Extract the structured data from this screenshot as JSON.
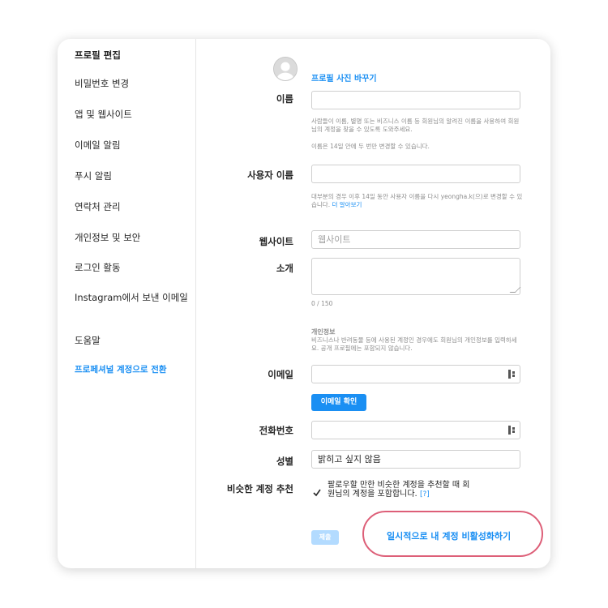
{
  "sidebar": {
    "items": [
      {
        "label": "프로필 편집"
      },
      {
        "label": "비밀번호 변경"
      },
      {
        "label": "앱 및 웹사이트"
      },
      {
        "label": "이메일 알림"
      },
      {
        "label": "푸시 알림"
      },
      {
        "label": "연락처 관리"
      },
      {
        "label": "개인정보 및 보안"
      },
      {
        "label": "로그인 활동"
      },
      {
        "label": "Instagram에서 보낸 이메일"
      },
      {
        "label": "도움말"
      },
      {
        "label": "프로페셔널 계정으로 전환"
      }
    ]
  },
  "profile": {
    "change_photo": "프로필 사진 바꾸기"
  },
  "form": {
    "name_label": "이름",
    "name_value": "",
    "name_help": "사람들이 이름, 별명 또는 비즈니스 이름 등 회원님의 알려진 이름을 사용하여 회원님의 계정을 찾을 수 있도록 도와주세요.",
    "name_help2": "이름은 14일 안에 두 번만 변경할 수 있습니다.",
    "username_label": "사용자 이름",
    "username_value": "",
    "username_help": "대부분의 경우 이후 14일 동안 사용자 이름을 다시 yeongha.k(으)로 변경할 수 있습니다.",
    "username_help_link": "더 알아보기",
    "website_label": "웹사이트",
    "website_placeholder": "웹사이트",
    "bio_label": "소개",
    "bio_counter": "0 / 150",
    "personal_title": "개인정보",
    "personal_help": "비즈니스나 반려동물 등에 사용된 계정인 경우에도 회원님의 개인정보를 입력하세요. 공개 프로필에는 포함되지 않습니다.",
    "email_label": "이메일",
    "email_value": "",
    "email_confirm": "이메일 확인",
    "phone_label": "전화번호",
    "phone_value": "",
    "gender_label": "성별",
    "gender_value": "밝히고 싶지 않음",
    "similar_label": "비슷한 계정 추천",
    "similar_text": "팔로우할 만한 비슷한 계정을 추천할 때 회원님의 계정을 포함합니다.",
    "similar_help": "[?]",
    "submit": "제출",
    "deactivate": "일시적으로 내 계정 비활성화하기"
  },
  "colors": {
    "accent": "#1a8ff3",
    "highlight": "#dd5f78"
  }
}
